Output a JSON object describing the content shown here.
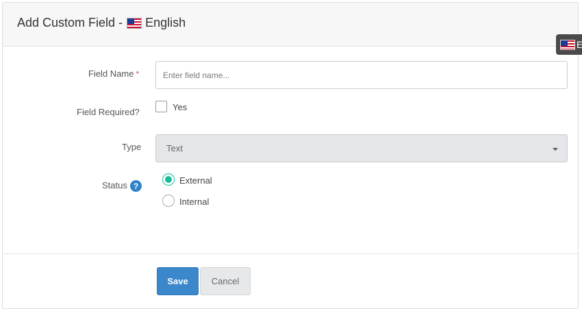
{
  "header": {
    "title": "Add Custom Field -",
    "language": "English",
    "flag_icon": "us-flag-icon"
  },
  "language_badge": {
    "text": "E",
    "flag_icon": "us-flag-icon"
  },
  "form": {
    "field_name": {
      "label": "Field Name",
      "required_marker": "*",
      "placeholder": "Enter field name...",
      "value": ""
    },
    "field_required": {
      "label": "Field Required?",
      "option_label": "Yes",
      "checked": false
    },
    "type": {
      "label": "Type",
      "selected": "Text"
    },
    "status": {
      "label": "Status",
      "help_icon": "?",
      "options": [
        {
          "label": "External",
          "selected": true
        },
        {
          "label": "Internal",
          "selected": false
        }
      ]
    }
  },
  "actions": {
    "save_label": "Save",
    "cancel_label": "Cancel"
  },
  "colors": {
    "primary": "#3a87cb",
    "radio_accent": "#1abc9c",
    "required": "#d9534f",
    "help": "#2e83c9"
  }
}
